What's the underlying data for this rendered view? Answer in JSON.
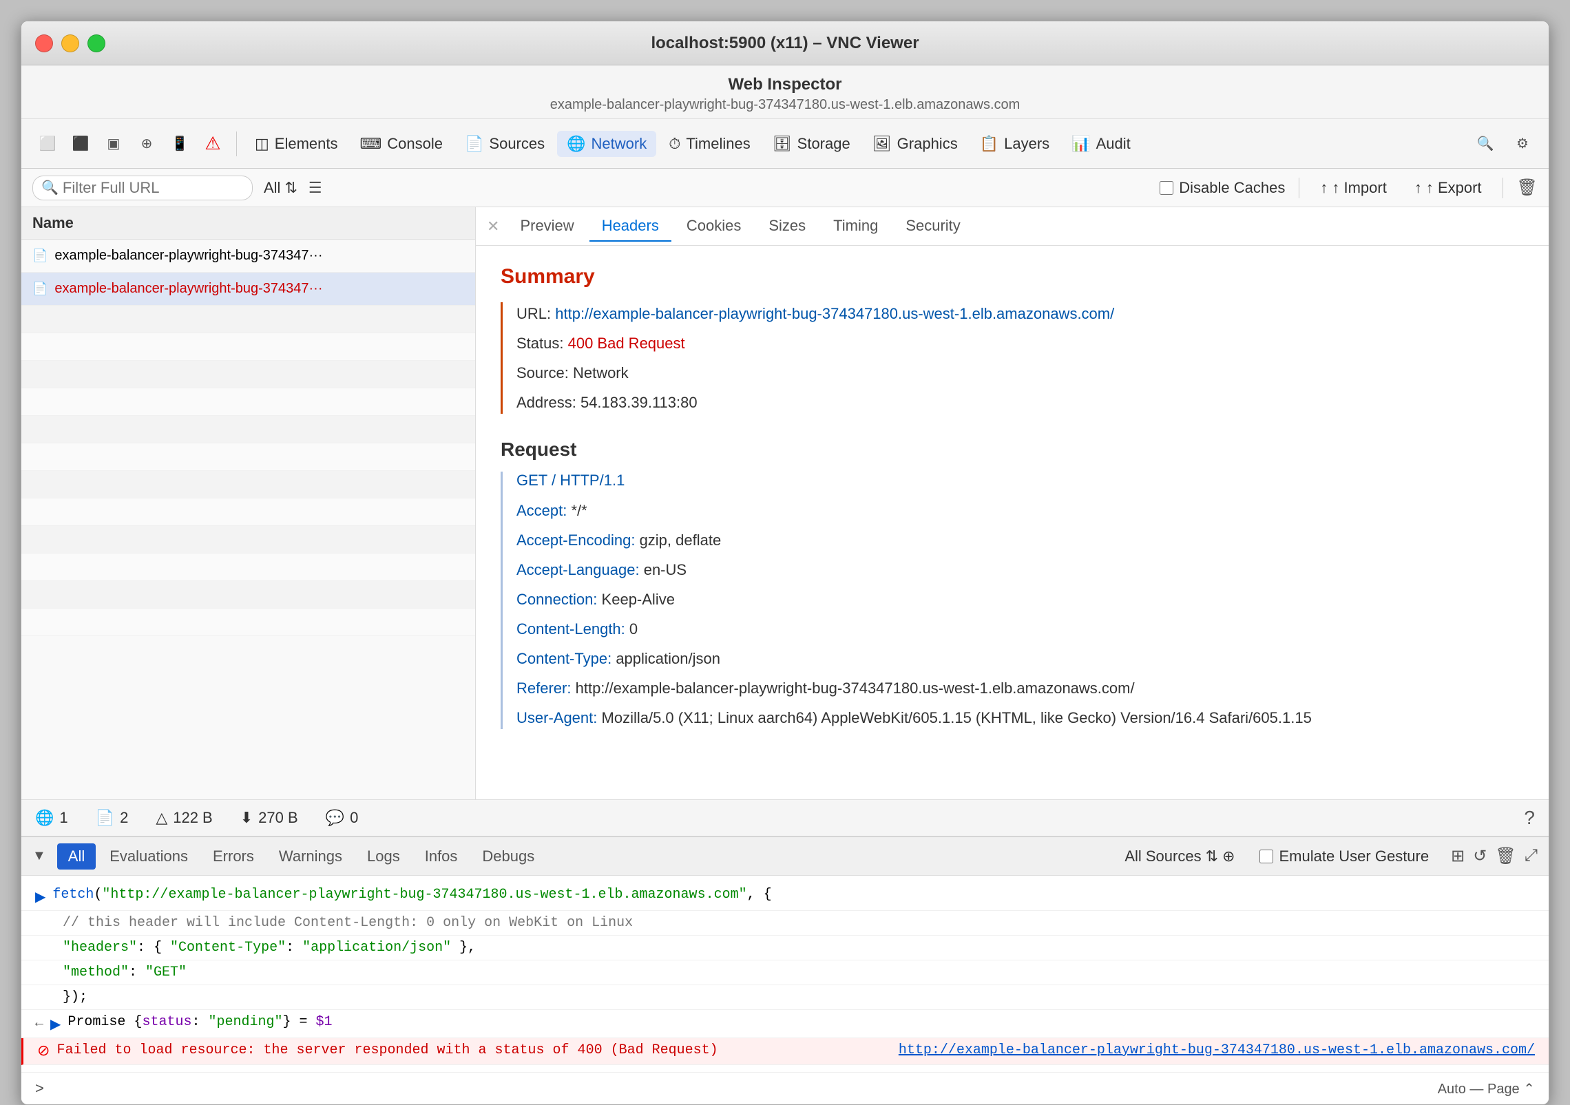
{
  "window": {
    "title": "localhost:5900 (x11) – VNC Viewer"
  },
  "inspector": {
    "title": "Web Inspector",
    "subtitle": "example-balancer-playwright-bug-374347180.us-west-1.elb.amazonaws.com"
  },
  "toolbar": {
    "items": [
      {
        "id": "elements",
        "label": "Elements",
        "icon": "◫"
      },
      {
        "id": "console",
        "label": "Console",
        "icon": "⌨"
      },
      {
        "id": "sources",
        "label": "Sources",
        "icon": "📄"
      },
      {
        "id": "network",
        "label": "Network",
        "icon": "🌐"
      },
      {
        "id": "timelines",
        "label": "Timelines",
        "icon": "⏱"
      },
      {
        "id": "storage",
        "label": "Storage",
        "icon": "🗄"
      },
      {
        "id": "graphics",
        "label": "Graphics",
        "icon": "🖼"
      },
      {
        "id": "layers",
        "label": "Layers",
        "icon": "📋"
      },
      {
        "id": "audit",
        "label": "Audit",
        "icon": "📊"
      }
    ]
  },
  "filterbar": {
    "placeholder": "Filter Full URL",
    "all_label": "All",
    "disable_caches": "Disable Caches",
    "import_label": "↑ Import",
    "export_label": "↑ Export"
  },
  "left_panel": {
    "header": "Name",
    "items": [
      {
        "text": "example-balancer-playwright-bug-374347···",
        "error": false
      },
      {
        "text": "example-balancer-playwright-bug-374347···",
        "error": true
      }
    ]
  },
  "tabs": {
    "items": [
      "Preview",
      "Headers",
      "Cookies",
      "Sizes",
      "Timing",
      "Security"
    ],
    "active": "Headers"
  },
  "summary": {
    "title": "Summary",
    "url_label": "URL:",
    "url_value": "http://example-balancer-playwright-bug-374347180.us-west-1.elb.amazonaws.com/",
    "status_label": "Status:",
    "status_value": "400 Bad Request",
    "source_label": "Source:",
    "source_value": "Network",
    "address_label": "Address:",
    "address_value": "54.183.39.113:80"
  },
  "request": {
    "title": "Request",
    "method": "GET / HTTP/1.1",
    "headers": [
      {
        "key": "Accept:",
        "val": "*/*"
      },
      {
        "key": "Accept-Encoding:",
        "val": "gzip, deflate"
      },
      {
        "key": "Accept-Language:",
        "val": "en-US"
      },
      {
        "key": "Connection:",
        "val": "Keep-Alive"
      },
      {
        "key": "Content-Length:",
        "val": "0"
      },
      {
        "key": "Content-Type:",
        "val": "application/json"
      },
      {
        "key": "Referer:",
        "val": "http://example-balancer-playwright-bug-374347180.us-west-1.elb.amazonaws.com/"
      },
      {
        "key": "User-Agent:",
        "val": "Mozilla/5.0 (X11; Linux aarch64) AppleWebKit/605.1.15 (KHTML, like Gecko) Version/16.4 Safari/605.1.15"
      }
    ]
  },
  "statusbar": {
    "items": [
      {
        "icon": "🌐",
        "text": "1"
      },
      {
        "icon": "📄",
        "text": "2"
      },
      {
        "icon": "△",
        "text": "122 B"
      },
      {
        "icon": "⬇",
        "text": "270 B"
      },
      {
        "icon": "💬",
        "text": "0"
      }
    ]
  },
  "console_toolbar": {
    "tabs": [
      "All",
      "Evaluations",
      "Errors",
      "Warnings",
      "Logs",
      "Infos",
      "Debugs"
    ],
    "active_tab": "All",
    "sources_label": "All Sources",
    "emulate_label": "Emulate User Gesture"
  },
  "console_lines": {
    "fetch_line": "> fetch(\"http://example-balancer-playwright-bug-374347180.us-west-1.elb.amazonaws.com\", {",
    "comment": "// this header will include Content-Length: 0 only on WebKit on Linux",
    "headers_line": "\"headers\": { \"Content-Type\": \"application/json\" },",
    "method_line": "\"method\": \"GET\"",
    "close_line": "});",
    "promise_line": "Promise {status: \"pending\"} = $1",
    "error_text": "Failed to load resource: the server responded with a status of 400 (Bad Request)",
    "error_link": "http://example-balancer-playwright-bug-374347180.us-west-1.elb.amazonaws.com/"
  },
  "console_input": {
    "prompt": ">",
    "right_label": "Auto — Page ⌃"
  }
}
